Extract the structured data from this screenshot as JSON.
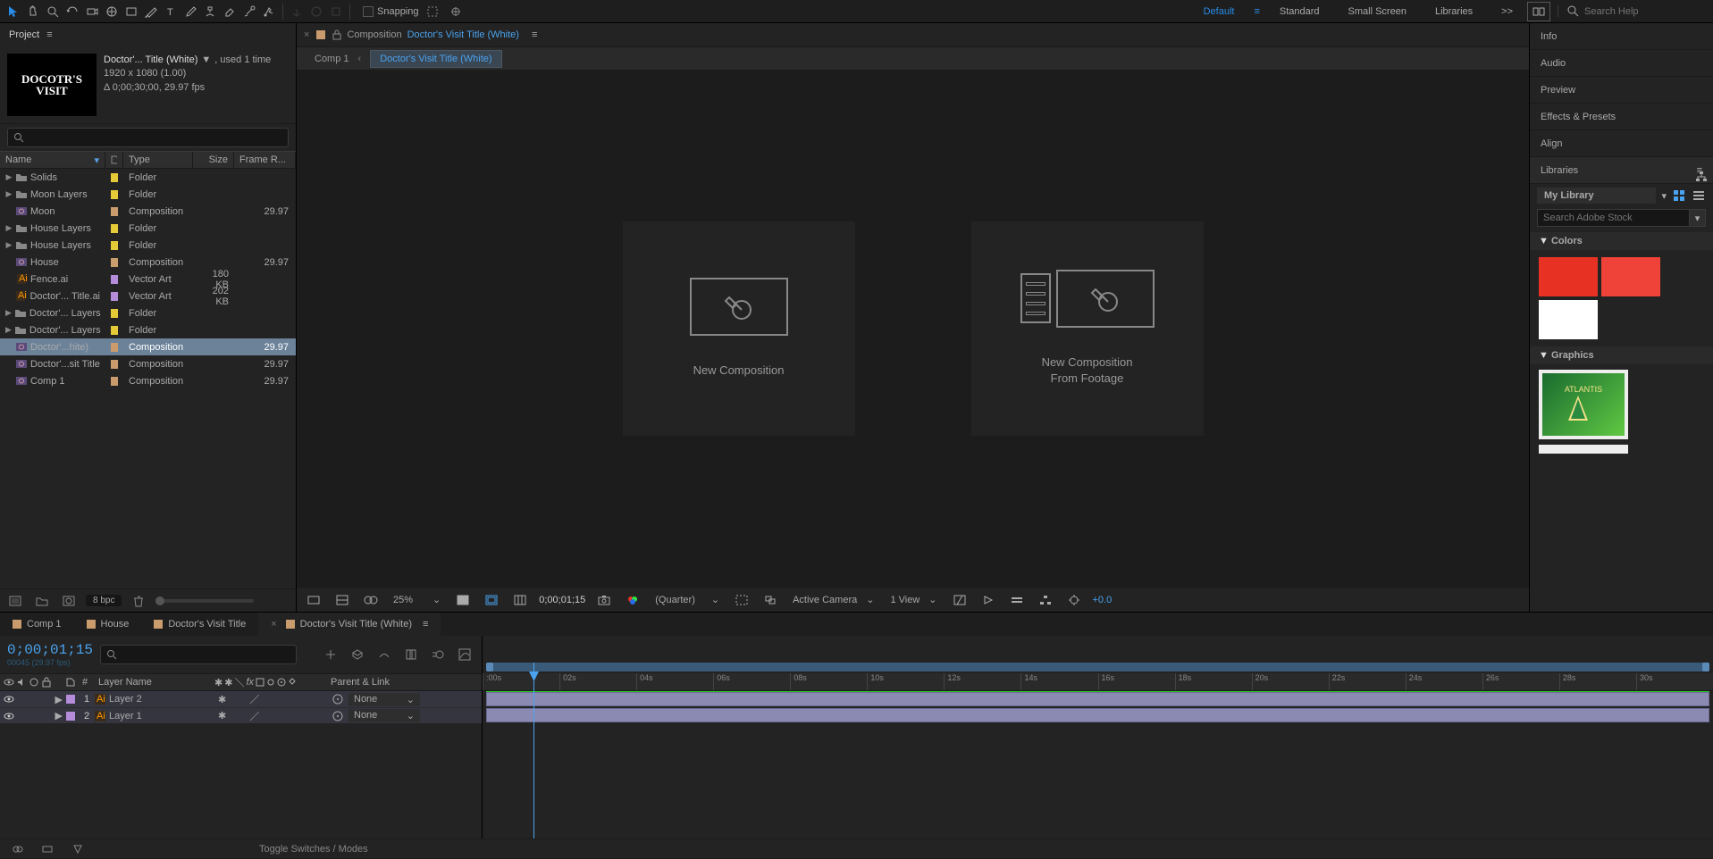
{
  "toolbar": {
    "snapping": "Snapping"
  },
  "workspaces": {
    "items": [
      "Default",
      "Standard",
      "Small Screen",
      "Libraries"
    ],
    "active": 0,
    "more": ">>",
    "search_placeholder": "Search Help"
  },
  "project": {
    "panel_title": "Project",
    "selected_name": "Doctor'... Title (White)",
    "used": ", used 1 time",
    "dims": "1920 x 1080 (1.00)",
    "duration": "Δ 0;00;30;00, 29.97 fps",
    "thumb_text": "DOCOTR'S VISIT",
    "columns": {
      "name": "Name",
      "type": "Type",
      "size": "Size",
      "fr": "Frame R..."
    },
    "items": [
      {
        "tw": "▶",
        "icon": "folder",
        "name": "Solids",
        "tag": "#e6c937",
        "type": "Folder",
        "size": "",
        "fr": ""
      },
      {
        "tw": "▶",
        "icon": "folder",
        "name": "Moon Layers",
        "tag": "#e6c937",
        "type": "Folder",
        "size": "",
        "fr": ""
      },
      {
        "tw": "",
        "icon": "comp",
        "name": "Moon",
        "tag": "#c99b6d",
        "type": "Composition",
        "size": "",
        "fr": "29.97"
      },
      {
        "tw": "▶",
        "icon": "folder",
        "name": "House Layers",
        "tag": "#e6c937",
        "type": "Folder",
        "size": "",
        "fr": ""
      },
      {
        "tw": "▶",
        "icon": "folder",
        "name": "House Layers",
        "tag": "#e6c937",
        "type": "Folder",
        "size": "",
        "fr": ""
      },
      {
        "tw": "",
        "icon": "comp",
        "name": "House",
        "tag": "#c99b6d",
        "type": "Composition",
        "size": "",
        "fr": "29.97"
      },
      {
        "tw": "",
        "icon": "ai",
        "name": "Fence.ai",
        "tag": "#b48cd9",
        "type": "Vector Art",
        "size": "180 KB",
        "fr": ""
      },
      {
        "tw": "",
        "icon": "ai",
        "name": "Doctor'... Title.ai",
        "tag": "#b48cd9",
        "type": "Vector Art",
        "size": "202 KB",
        "fr": ""
      },
      {
        "tw": "▶",
        "icon": "folder",
        "name": "Doctor'... Layers",
        "tag": "#e6c937",
        "type": "Folder",
        "size": "",
        "fr": ""
      },
      {
        "tw": "▶",
        "icon": "folder",
        "name": "Doctor'... Layers",
        "tag": "#e6c937",
        "type": "Folder",
        "size": "",
        "fr": ""
      },
      {
        "tw": "",
        "icon": "comp",
        "name": "Doctor'...hite)",
        "tag": "#c99b6d",
        "type": "Composition",
        "size": "",
        "fr": "29.97",
        "selected": true
      },
      {
        "tw": "",
        "icon": "comp",
        "name": "Doctor'...sit Title",
        "tag": "#c99b6d",
        "type": "Composition",
        "size": "",
        "fr": "29.97"
      },
      {
        "tw": "",
        "icon": "comp",
        "name": "Comp 1",
        "tag": "#c99b6d",
        "type": "Composition",
        "size": "",
        "fr": "29.97"
      }
    ],
    "depth": "8 bpc"
  },
  "composition": {
    "label": "Composition",
    "active": "Doctor's Visit Title (White)",
    "flow": [
      "Comp 1",
      "Doctor's Visit Title (White)"
    ],
    "cards": {
      "new": "New Composition",
      "from": "New Composition\nFrom Footage"
    },
    "footer": {
      "zoom": "25%",
      "time": "0;00;01;15",
      "quality": "(Quarter)",
      "camera": "Active Camera",
      "views": "1 View",
      "exposure": "+0.0"
    }
  },
  "right": {
    "panels": [
      "Info",
      "Audio",
      "Preview",
      "Effects & Presets",
      "Align",
      "Libraries"
    ],
    "lib_name": "My Library",
    "stock_placeholder": "Search Adobe Stock",
    "colors_hdr": "Colors",
    "colors": [
      "#e73223",
      "#ef4238",
      "#ffffff"
    ],
    "graphics_hdr": "Graphics",
    "graphic_label": "ATLANTIS"
  },
  "timeline": {
    "tabs": [
      {
        "name": "Comp 1",
        "act": false
      },
      {
        "name": "House",
        "act": false
      },
      {
        "name": "Doctor's Visit Title",
        "act": false
      },
      {
        "name": "Doctor's Visit Title (White)",
        "act": true
      }
    ],
    "timecode": "0;00;01;15",
    "tc_sub": "00045 (29.97 fps)",
    "col_layer": "Layer Name",
    "col_parent": "Parent & Link",
    "ticks": [
      ":00s",
      "02s",
      "04s",
      "06s",
      "08s",
      "10s",
      "12s",
      "14s",
      "16s",
      "18s",
      "20s",
      "22s",
      "24s",
      "26s",
      "28s",
      "30s"
    ],
    "layers": [
      {
        "num": "1",
        "name": "Layer 2",
        "parent": "None"
      },
      {
        "num": "2",
        "name": "Layer 1",
        "parent": "None"
      }
    ],
    "footer": "Toggle Switches / Modes"
  }
}
